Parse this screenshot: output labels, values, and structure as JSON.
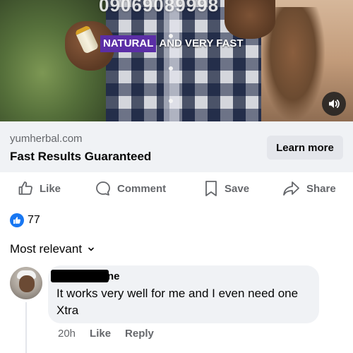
{
  "video": {
    "overlay_number": "09069089998",
    "caption_highlight": "NATURAL",
    "caption_rest": "AND VERY FAST",
    "sound_icon": "speaker-on-icon"
  },
  "ad_link": {
    "domain": "yumherbal.com",
    "title": "Fast Results Guaranteed",
    "cta_label": "Learn more"
  },
  "actions": [
    {
      "label": "Like",
      "icon": "thumbs-up-icon"
    },
    {
      "label": "Comment",
      "icon": "comment-bubble-icon"
    },
    {
      "label": "Save",
      "icon": "bookmark-icon"
    },
    {
      "label": "Share",
      "icon": "share-arrow-icon"
    }
  ],
  "reactions": {
    "count": "77",
    "icon": "like-reaction-icon"
  },
  "comments_sort": {
    "label": "Most relevant",
    "icon": "chevron-down-icon"
  },
  "comment": {
    "author_visible": "ne",
    "text": "It works very well for me and I even need one Xtra",
    "time": "20h",
    "like_label": "Like",
    "reply_label": "Reply"
  },
  "colors": {
    "accent": "#1877f2",
    "secondary_text": "#65676b",
    "caption_highlight_bg": "#5b2ea6",
    "link_bar_bg": "#f0f2f5"
  }
}
